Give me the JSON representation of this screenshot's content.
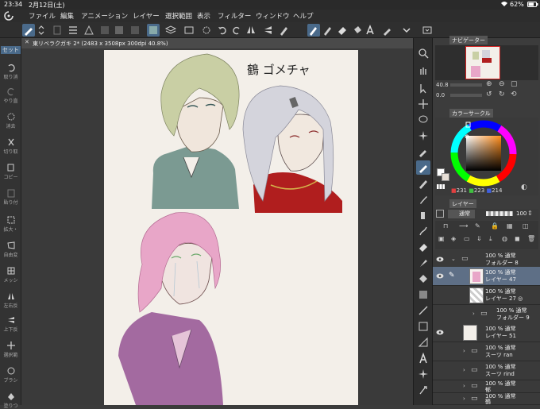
{
  "status_bar": {
    "time": "23:34",
    "date": "2月12日(土)",
    "battery": "62%"
  },
  "menu": [
    "ファイル",
    "編集",
    "アニメーション",
    "レイヤー",
    "選択範囲",
    "表示",
    "フィルター",
    "ウィンドウ",
    "ヘルプ"
  ],
  "left_tools": [
    {
      "label": "セット",
      "icon": "set-icon"
    },
    {
      "label": "取り消",
      "icon": "undo-icon"
    },
    {
      "label": "やり直",
      "icon": "redo-icon"
    },
    {
      "label": "消去",
      "icon": "erase-icon"
    },
    {
      "label": "切り取",
      "icon": "cut-icon"
    },
    {
      "label": "コピー",
      "icon": "copy-icon"
    },
    {
      "label": "貼り付",
      "icon": "paste-icon"
    },
    {
      "label": "拡大・",
      "icon": "transform-icon"
    },
    {
      "label": "自由変",
      "icon": "free-transform-icon"
    },
    {
      "label": "メッシ",
      "icon": "mesh-icon"
    },
    {
      "label": "左右反",
      "icon": "flip-horizontal-icon"
    },
    {
      "label": "上下反",
      "icon": "flip-vertical-icon"
    },
    {
      "label": "選択範",
      "icon": "move-selection-icon"
    },
    {
      "label": "ブラシ",
      "icon": "brush-icon"
    },
    {
      "label": "塗りつ",
      "icon": "fill-icon"
    }
  ],
  "document_tab": "東リベラクガキ 2* (2483 x 3508px 300dpi 40.8%)",
  "canvas_handwriting": "鶴 ゴメチャ",
  "navigator": {
    "tab": "ナビゲーター",
    "zoom": "40.8",
    "rotation": "0.0"
  },
  "color_circle": {
    "tab": "カラーサークル",
    "r": "231",
    "g": "223",
    "b": "214",
    "hue_color": "#ff9a2a"
  },
  "layer_panel": {
    "tab": "レイヤー",
    "blend_mode": "通常",
    "opacity": "100",
    "layers": [
      {
        "line1": "100 % 通常",
        "line2": "フォルダー 8",
        "kind": "folder",
        "expanded": true
      },
      {
        "line1": "100 % 通常",
        "line2": "レイヤー 47",
        "kind": "layer",
        "selected": true
      },
      {
        "line1": "100 % 通常",
        "line2": "レイヤー 27 ◎",
        "kind": "layer"
      },
      {
        "line1": "100 % 通常",
        "line2": "フォルダー 9",
        "kind": "folder"
      },
      {
        "line1": "100 % 通常",
        "line2": "レイヤー 51",
        "kind": "layer"
      },
      {
        "line1": "100 % 通常",
        "line2": "スーツ ran",
        "kind": "folder"
      },
      {
        "line1": "100 % 通常",
        "line2": "スーツ rind",
        "kind": "folder"
      },
      {
        "line1": "100 % 通常",
        "line2": "郁",
        "kind": "folder"
      },
      {
        "line1": "100 % 通常",
        "line2": "鶴",
        "kind": "folder"
      }
    ]
  }
}
